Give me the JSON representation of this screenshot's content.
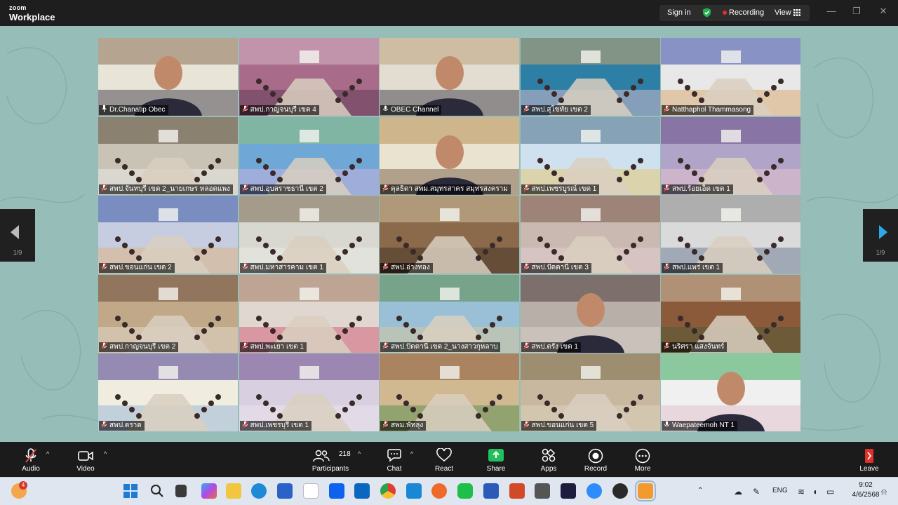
{
  "app": {
    "brand_small": "zoom",
    "brand_large": "Workplace"
  },
  "titlebar": {
    "sign_in": "Sign in",
    "recording": "Recording",
    "view": "View",
    "minimize": "—",
    "maximize": "❐",
    "close": "✕"
  },
  "nav": {
    "prev_page": "1/9",
    "next_page": "1/9"
  },
  "tiles": [
    {
      "name": "Dr.Chanatip Obec",
      "muted": false,
      "pinned": true,
      "active": true
    },
    {
      "name": "สพป.กาญจนบุรี เขต 4",
      "muted": true
    },
    {
      "name": "OBEC Channel",
      "muted": false
    },
    {
      "name": "สพป.สุโขทัย เขต 2",
      "muted": true
    },
    {
      "name": "Natthaphol Thammasong",
      "muted": true
    },
    {
      "name": "สพป.จันทบุรี เขต 2_นายเกษร หลอดแพง",
      "muted": true
    },
    {
      "name": "สพป.อุบลราชธานี เขต 2",
      "muted": true
    },
    {
      "name": "คุลธิดา สพม.สมุทรสาคร สมุทรสงคราม",
      "muted": true
    },
    {
      "name": "สพป.เพชรบูรณ์ เขต 1",
      "muted": true
    },
    {
      "name": "สพป.ร้อยเอ็ด เขต 1",
      "muted": true
    },
    {
      "name": "สพป.ขอนแก่น เขต 2",
      "muted": true
    },
    {
      "name": "สพป.มหาสารคาม เขต 1",
      "muted": true
    },
    {
      "name": "สพป.อ่างทอง",
      "muted": true
    },
    {
      "name": "สพป.ปัตตานี เขต 3",
      "muted": true
    },
    {
      "name": "สพป.แพร่ เขต 1",
      "muted": true
    },
    {
      "name": "สพป.กาญจนบุรี เขต 2",
      "muted": true
    },
    {
      "name": "สพป.พะเยา เขต 1",
      "muted": true
    },
    {
      "name": "สพป.ปัตตานี เขต 2_นางสาวกุหลาบ",
      "muted": true
    },
    {
      "name": "สพป.ตรัง เขต 1",
      "muted": true
    },
    {
      "name": "นริศรา แสงจันทร์",
      "muted": true
    },
    {
      "name": "สพป.ตราด",
      "muted": true
    },
    {
      "name": "สพป.เพชรบุรี เขต 1",
      "muted": true
    },
    {
      "name": "สพม.พัทลุง",
      "muted": true
    },
    {
      "name": "สพป.ขอนแก่น เขต 5",
      "muted": true
    },
    {
      "name": "Waepateemoh NT 1",
      "muted": false
    }
  ],
  "toolbar": {
    "audio": "Audio",
    "video": "Video",
    "participants": "Participants",
    "participants_count": "218",
    "chat": "Chat",
    "react": "React",
    "share": "Share",
    "apps": "Apps",
    "record": "Record",
    "more": "More",
    "leave": "Leave"
  },
  "taskbar": {
    "notification_count": "4",
    "language": "ENG",
    "time": "9:02",
    "date": "4/6/2568"
  },
  "colors": {
    "stage": "#96bdb7",
    "active_outline": "#3ad35a",
    "share": "#21c05a",
    "record_dot": "#e0302a"
  }
}
